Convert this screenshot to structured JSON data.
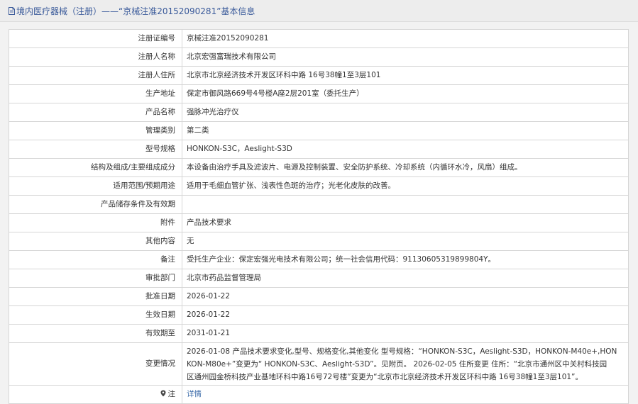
{
  "header": {
    "title": "境内医疗器械（注册）——“京械注准20152090281”基本信息"
  },
  "rows": [
    {
      "label": "注册证编号",
      "value": "京械注准20152090281"
    },
    {
      "label": "注册人名称",
      "value": "北京宏强富瑞技术有限公司"
    },
    {
      "label": "注册人住所",
      "value": "北京市北京经济技术开发区环科中路 16号38幢1至3层101"
    },
    {
      "label": "生产地址",
      "value": "保定市御风路669号4号楼A座2层201室（委托生产）"
    },
    {
      "label": "产品名称",
      "value": "强脉冲光治疗仪"
    },
    {
      "label": "管理类别",
      "value": "第二类"
    },
    {
      "label": "型号规格",
      "value": "HONKON-S3C，Aeslight-S3D"
    },
    {
      "label": "结构及组成/主要组成成分",
      "value": "本设备由治疗手具及滤波片、电源及控制装置、安全防护系统、冷却系统（内循环水冷，风扇）组成。"
    },
    {
      "label": "适用范围/预期用途",
      "value": "适用于毛细血管扩张、浅表性色斑的治疗；光老化皮肤的改善。"
    },
    {
      "label": "产品储存条件及有效期",
      "value": ""
    },
    {
      "label": "附件",
      "value": "产品技术要求"
    },
    {
      "label": "其他内容",
      "value": "无"
    },
    {
      "label": "备注",
      "value": "受托生产企业：保定宏强光电技术有限公司；统一社会信用代码：91130605319899804Y。"
    },
    {
      "label": "审批部门",
      "value": "北京市药品监督管理局"
    },
    {
      "label": "批准日期",
      "value": "2026-01-22"
    },
    {
      "label": "生效日期",
      "value": "2026-01-22"
    },
    {
      "label": "有效期至",
      "value": "2031-01-21"
    }
  ],
  "change": {
    "label": "变更情况",
    "lines": [
      "2026-01-08 产品技术要求变化,型号、规格变化,其他变化 型号规格：“HONKON-S3C，Aeslight-S3D，HONKON-M40e+,HON",
      "KON-M80e+”变更为“ HONKON-S3C、Aeslight-S3D”。见附页。 2026-02-05 住所变更 住所：“北京市通州区中关村科技园",
      "区通州园金桥科技产业基地环科中路16号72号楼”变更为“北京市北京经济技术开发区环科中路 16号38幢1至3层101”。"
    ]
  },
  "note": {
    "label": "注",
    "link_text": "详情"
  },
  "colors": {
    "title": "#3a5a9a",
    "link": "#3a6aa8",
    "border": "#d6d6d6",
    "header_bg": "#ededed",
    "page_bg": "#f2f2f2"
  },
  "icons": {
    "title_icon": "document-icon",
    "note_icon": "location-pin-icon"
  }
}
